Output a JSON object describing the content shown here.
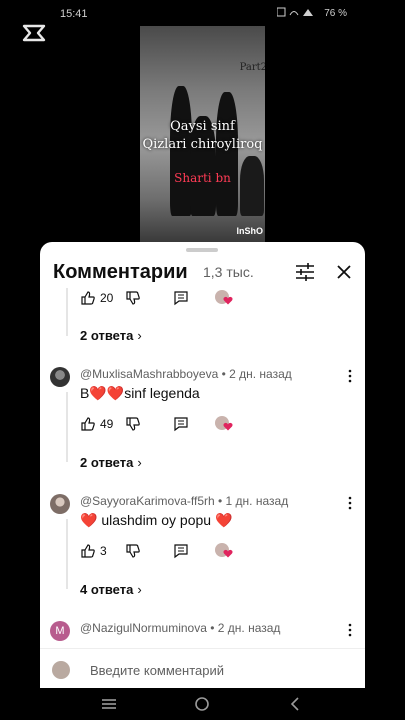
{
  "status_bar": {
    "time": "15:41",
    "battery": "76 %"
  },
  "video": {
    "overlay_line1": "Qaysi sinf",
    "overlay_line2": "Qizlari chiroyliroq",
    "overlay_red": "Sharti bn",
    "part_label": "Part2",
    "watermark": "InShO"
  },
  "comments_panel": {
    "title": "Комментарии",
    "count": "1,3 тыс.",
    "top_action": {
      "likes": "20"
    },
    "replies_1": "2 ответа",
    "comments": [
      {
        "author": "@MuxlisaMashrabboyeva • 2 дн. назад",
        "text": "B❤️❤️sinf legenda",
        "likes": "49",
        "replies": "2 ответа"
      },
      {
        "author": "@SayyoraKarimova-ff5rh • 1 дн. назад",
        "text": "❤️ ulashdim oy popu ❤️",
        "likes": "3",
        "replies": "4 ответа"
      },
      {
        "author": "@NazigulNormuminova • 2 дн. назад",
        "avatar_letter": "M"
      }
    ],
    "input_placeholder": "Введите комментарий"
  },
  "colors": {
    "accent_heart": "#e0245e",
    "secondary_text": "#606060",
    "avatar_purple": "#b85c8e"
  }
}
